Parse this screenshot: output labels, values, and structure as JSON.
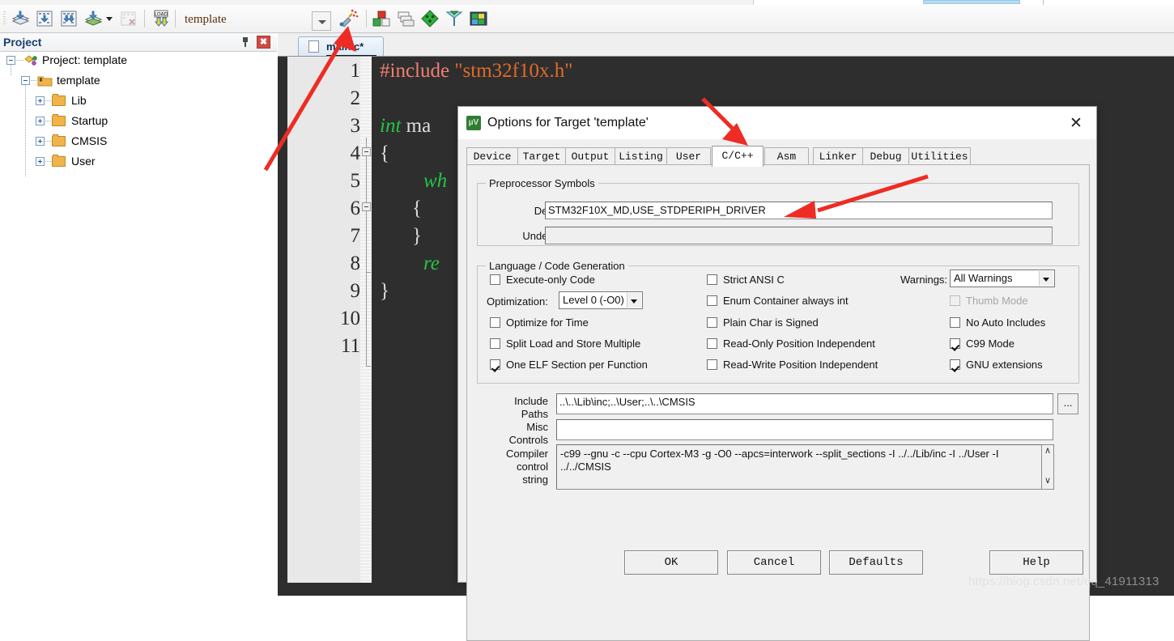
{
  "toolbar": {
    "project_name": "template",
    "icons": [
      "translate-icon",
      "build-icon",
      "rebuild-icon",
      "batch-build-icon",
      "batch-build-dropdown-icon",
      "stop-build-icon",
      "load-icon",
      "combo-dropdown-icon",
      "target-options-icon",
      "manage-components-icon",
      "multi-project-icon",
      "configuration-wizard-icon",
      "debug-settings-icon",
      "pack-installer-icon"
    ]
  },
  "project_panel": {
    "title": "Project",
    "pin_icon": "pin-icon",
    "close_icon": "close-icon",
    "tree": [
      {
        "label": "Project: template",
        "depth": 0,
        "icon": "project-icon",
        "expander": "minus"
      },
      {
        "label": "template",
        "depth": 1,
        "icon": "target-folder-icon",
        "expander": "minus"
      },
      {
        "label": "Lib",
        "depth": 2,
        "icon": "folder-icon",
        "expander": "plus"
      },
      {
        "label": "Startup",
        "depth": 2,
        "icon": "folder-icon",
        "expander": "plus"
      },
      {
        "label": "CMSIS",
        "depth": 2,
        "icon": "folder-icon",
        "expander": "plus"
      },
      {
        "label": "User",
        "depth": 2,
        "icon": "folder-icon",
        "expander": "plus"
      }
    ]
  },
  "editor": {
    "tab_label": "main.c*",
    "line_numbers": [
      "1",
      "2",
      "3",
      "4",
      "5",
      "6",
      "7",
      "8",
      "9",
      "10",
      "11"
    ],
    "code": [
      {
        "n": 1,
        "pp": "#include",
        "str": "\"stm32f10x.h\""
      },
      {
        "n": 3,
        "kw": "int",
        "txt": " ma"
      },
      {
        "n": 4,
        "txt": "{"
      },
      {
        "n": 5,
        "kw": "wh"
      },
      {
        "n": 6,
        "txt": "{"
      },
      {
        "n": 7,
        "txt": "}"
      },
      {
        "n": 8,
        "kw": "re"
      },
      {
        "n": 9,
        "txt": "}"
      }
    ]
  },
  "dialog": {
    "title": "Options for Target 'template'",
    "app_icon": "keil-uvision-icon",
    "close_label": "✕",
    "tabs": [
      {
        "label": "Device",
        "active": false
      },
      {
        "label": "Target",
        "active": false
      },
      {
        "label": "Output",
        "active": false
      },
      {
        "label": "Listing",
        "active": false
      },
      {
        "label": "User",
        "active": false
      },
      {
        "label": "C/C++",
        "active": true
      },
      {
        "label": "Asm",
        "active": false
      },
      {
        "label": "Linker",
        "active": false
      },
      {
        "label": "Debug",
        "active": false
      },
      {
        "label": "Utilities",
        "active": false
      }
    ],
    "preprocessor": {
      "group_title": "Preprocessor Symbols",
      "define_label": "Define:",
      "define_value": "STM32F10X_MD,USE_STDPERIPH_DRIVER",
      "undefine_label": "Undefine:",
      "undefine_value": ""
    },
    "language": {
      "group_title": "Language / Code Generation",
      "col1": [
        {
          "label": "Execute-only Code",
          "checked": false,
          "disabled": false
        },
        {
          "label": "Optimize for Time",
          "checked": false,
          "disabled": false
        },
        {
          "label": "Split Load and Store Multiple",
          "checked": false,
          "disabled": false
        },
        {
          "label": "One ELF Section per Function",
          "checked": true,
          "disabled": false
        }
      ],
      "optimization_label": "Optimization:",
      "optimization_value": "Level 0 (-O0)",
      "col2": [
        {
          "label": "Strict ANSI C",
          "checked": false,
          "disabled": false
        },
        {
          "label": "Enum Container always int",
          "checked": false,
          "disabled": false
        },
        {
          "label": "Plain Char is Signed",
          "checked": false,
          "disabled": false
        },
        {
          "label": "Read-Only Position Independent",
          "checked": false,
          "disabled": false
        },
        {
          "label": "Read-Write Position Independent",
          "checked": false,
          "disabled": false
        }
      ],
      "warnings_label": "Warnings:",
      "warnings_value": "All Warnings",
      "col3": [
        {
          "label": "Thumb Mode",
          "checked": false,
          "disabled": true
        },
        {
          "label": "No Auto Includes",
          "checked": false,
          "disabled": false
        },
        {
          "label": "C99 Mode",
          "checked": true,
          "disabled": false
        },
        {
          "label": "GNU extensions",
          "checked": true,
          "disabled": false
        }
      ]
    },
    "paths": {
      "include_label_1": "Include",
      "include_label_2": "Paths",
      "include_value": "..\\..\\Lib\\inc;..\\User;..\\..\\CMSIS",
      "browse_label": "...",
      "misc_label_1": "Misc",
      "misc_label_2": "Controls",
      "misc_value": "",
      "compiler_label_1": "Compiler",
      "compiler_label_2": "control",
      "compiler_label_3": "string",
      "compiler_value": "-c99 --gnu -c --cpu Cortex-M3 -g -O0 --apcs=interwork --split_sections -I ../../Lib/inc -I ../User -I ../../CMSIS",
      "scroll_up": "∧",
      "scroll_down": "∨"
    },
    "buttons": {
      "ok": "OK",
      "cancel": "Cancel",
      "defaults": "Defaults",
      "help": "Help"
    }
  },
  "annotations": {
    "arrows": [
      "arrow-to-target-options-button",
      "arrow-to-ccpp-tab",
      "arrow-to-define-field"
    ],
    "arrow_color": "#ee2b24"
  },
  "watermark": "https://blog.csdn.net/qq_41911313",
  "colors": {
    "accent_red": "#ee2b24",
    "code_bg": "#2e2e2e",
    "dialog_bg": "#f0f0f0",
    "panel_title": "#1d3f70"
  }
}
